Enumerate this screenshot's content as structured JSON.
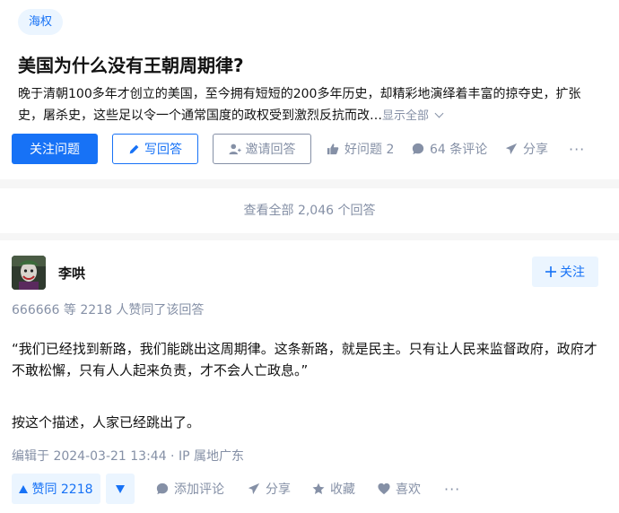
{
  "question": {
    "topic": "海权",
    "title": "美国为什么没有王朝周期律?",
    "excerpt_line1": "晚于清朝100多年才创立的美国，至今拥有短短的200多年历史，却精彩地演绎着丰富的掠夺史，扩张",
    "excerpt_line2": "史，屠杀史，这些足以令一个通常国度的政权受到激烈反抗而改…",
    "show_all_label": "显示全部",
    "follow_label": "关注问题",
    "write_answer_label": "写回答",
    "invite_label": "邀请回答",
    "good_question_label": "好问题 2",
    "comments_label": "64 条评论",
    "share_label": "分享",
    "more_label": "···"
  },
  "answers_summary": {
    "view_all_label": "查看全部 2,046 个回答"
  },
  "answer": {
    "author_name": "李哄",
    "follow_label": "关注",
    "upvoters_text": "666666 等 2218 人赞同了该回答",
    "paragraphs": [
      "“我们已经找到新路，我们能跳出这周期律。这条新路，就是民主。只有让人民来监督政府，政府才不敢松懈，只有人人起来负责，才不会人亡政息。”",
      "按这个描述，人家已经跳出了。"
    ],
    "edit_info": "编辑于 2024-03-21 13:44 · IP 属地广东",
    "upvote_label": "赞同 2218",
    "add_comment_label": "添加评论",
    "share_label": "分享",
    "collect_label": "收藏",
    "like_label": "喜欢",
    "more_label": "···"
  },
  "colors": {
    "accent": "#1772f6",
    "accent_light": "#ebf5ff",
    "muted": "#8590a6",
    "text": "#121212",
    "background": "#f6f6f6"
  },
  "icons": [
    "pencil-icon",
    "invite-user-icon",
    "thumb-up-icon",
    "comment-bubble-icon",
    "share-arrow-icon",
    "plus-icon",
    "triangle-up-icon",
    "triangle-down-icon",
    "star-icon",
    "heart-icon",
    "chevron-down-icon"
  ]
}
